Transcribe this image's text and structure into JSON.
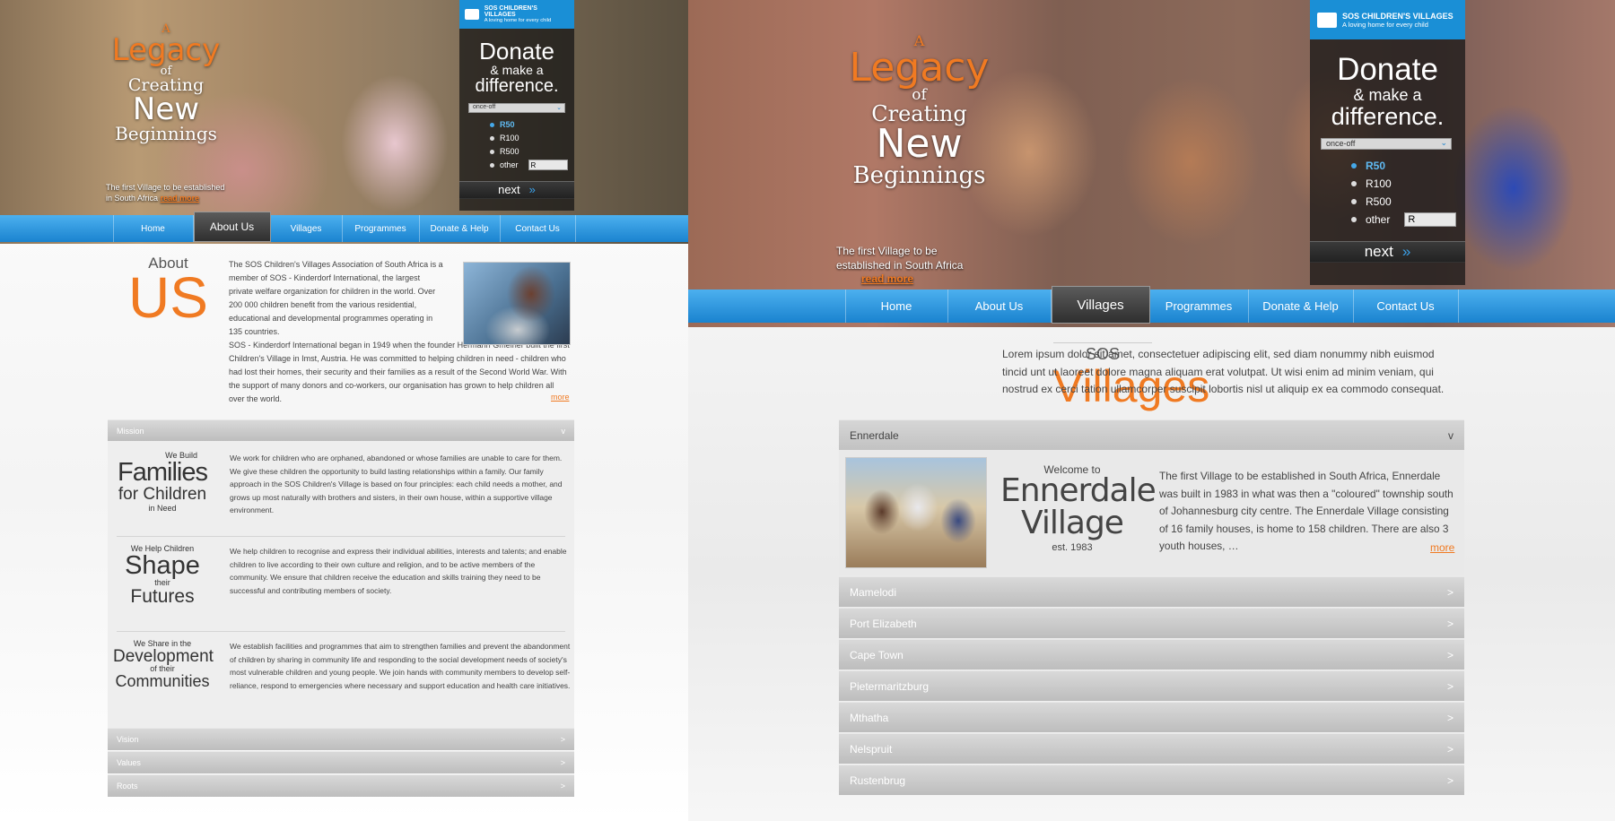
{
  "left": {
    "hero": {
      "a": "A",
      "legacy": "Legacy",
      "of": "of",
      "creating": "Creating",
      "new": "New",
      "beginnings": "Beginnings",
      "first_village": "The first Village to be established in South Africa",
      "read_more": "read more"
    },
    "donate": {
      "sos_name": "SOS CHILDREN'S VILLAGES",
      "sos_tag": "A loving home for every child",
      "heading1": "Donate",
      "heading2": "& make a",
      "heading3": "difference.",
      "frequency": "once-off",
      "amounts": [
        "R50",
        "R100",
        "R500",
        "other"
      ],
      "other_prefix": "R",
      "next": "next",
      "chev": "»"
    },
    "nav": [
      "Home",
      "About Us",
      "Villages",
      "Programmes",
      "Donate & Help",
      "Contact Us"
    ],
    "about": {
      "small": "About",
      "big": "US",
      "p1": "The SOS Children's Villages Association of South Africa is a member of SOS - Kinderdorf International, the largest private welfare organization for children in the world. Over 200 000 children benefit from the various residential, educational and developmental programmes operating in 135 countries.",
      "p2": "SOS - Kinderdorf International began in 1949 when the founder Hermann Gmeiner built the first Children's Village in Imst, Austria. He was committed to helping children in need - children who had lost their homes, their security and their families as a result of the Second World War. With the support of many donors and co-workers, our organisation has grown to help children all over the world.",
      "more": "more"
    },
    "accordion": {
      "mission": "Mission",
      "vision": "Vision",
      "values": "Values",
      "roots": "Roots",
      "open_chev": "v",
      "closed_chev": ">"
    },
    "blocks": [
      {
        "top": "We Build",
        "big1": "Families",
        "big2": "for Children",
        "bottom": "in Need",
        "text": "We work for children who are orphaned, abandoned or whose families are unable to care for them. We give these children the opportunity to build lasting relationships within a family. Our family approach in the SOS Children's Village is based on four principles: each child needs a mother, and grows up most naturally with brothers and sisters, in their own house, within a supportive village environment."
      },
      {
        "top": "We Help Children",
        "big1": "Shape",
        "big2": "Futures",
        "bottom": "their",
        "text": "We help children to recognise and express their individual abilities, interests and talents; and enable children to live according to their own culture and religion, and to be active members of the community. We ensure that children receive the education and skills training they need to be successful and contributing members of society."
      },
      {
        "top": "We Share in the",
        "big1": "Development",
        "big2": "Communities",
        "bottom": "of their",
        "text": "We establish facilities and programmes that aim to strengthen families and prevent the abandonment of children by sharing in community life and responding to the social development needs of society's most vulnerable children and young people. We join hands with community members to develop self-reliance, respond to emergencies where necessary and support education and health care initiatives."
      }
    ]
  },
  "right": {
    "hero": {
      "a": "A",
      "legacy": "Legacy",
      "of": "of",
      "creating": "Creating",
      "new": "New",
      "beginnings": "Beginnings",
      "first_village": "The first Village to be established in South Africa",
      "read_more": "read more"
    },
    "donate": {
      "sos_name": "SOS CHILDREN'S VILLAGES",
      "sos_tag": "A loving home for every child",
      "heading1": "Donate",
      "heading2": "& make a",
      "heading3": "difference.",
      "frequency": "once-off",
      "amounts": [
        "R50",
        "R100",
        "R500",
        "other"
      ],
      "other_prefix": "R",
      "next": "next",
      "chev": "»"
    },
    "nav": [
      "Home",
      "About Us",
      "Villages",
      "Programmes",
      "Donate & Help",
      "Contact Us"
    ],
    "villages": {
      "small": "SOS",
      "big": "Villages",
      "intro": "Lorem ipsum dolor sit amet, consectetuer adipiscing elit, sed diam nonummy nibh euismod tincid unt ut laoreet dolore magna aliquam erat volutpat. Ut wisi enim ad minim veniam, qui nostrud ex cerci tation ullamcorper suscipit lobortis nisl ut aliquip ex ea commodo consequat."
    },
    "enn": {
      "title": "Ennerdale",
      "chev": "v",
      "welcome": "Welcome to",
      "name1": "Ennerdale",
      "name2": "Village",
      "est": "est. 1983",
      "text": "The first Village to be established in South Africa, Ennerdale was built in 1983 in what was then a \"coloured\" township south of Johannesburg city centre. The Ennerdale Village consisting of 16 family houses, is home to 158 children. There are also 3 youth houses, …",
      "more": "more"
    },
    "others": [
      "Mamelodi",
      "Port Elizabeth",
      "Cape Town",
      "Pietermaritzburg",
      "Mthatha",
      "Nelspruit",
      "Rustenbrug"
    ],
    "closed_chev": ">"
  }
}
